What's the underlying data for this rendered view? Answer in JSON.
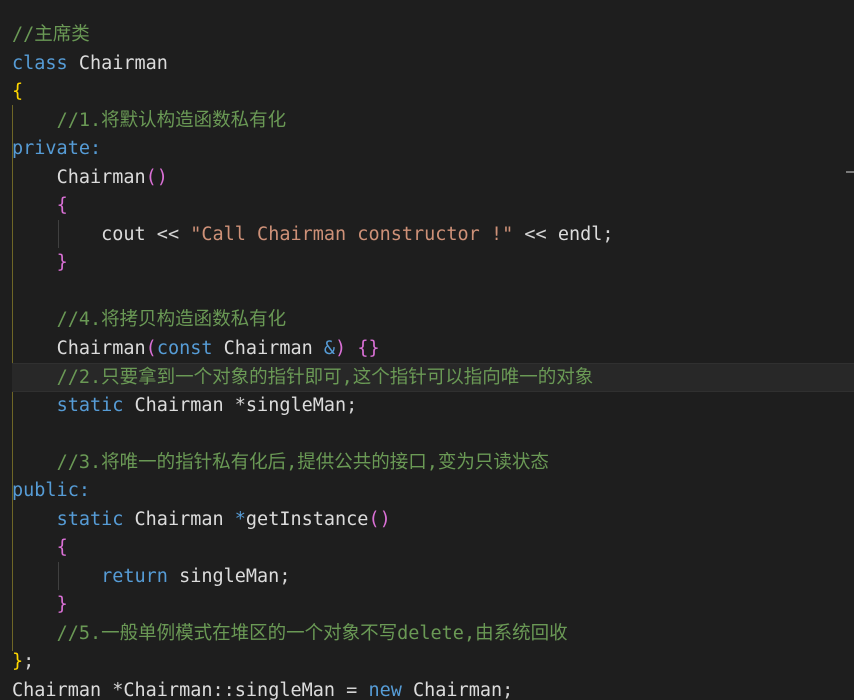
{
  "editor": {
    "language": "C++",
    "lines": [
      {
        "indent": "",
        "tokens": [
          {
            "t": "//主席类",
            "c": "t-comment"
          }
        ]
      },
      {
        "indent": "",
        "tokens": [
          {
            "t": "class",
            "c": "t-kw"
          },
          {
            "t": " "
          },
          {
            "t": "Chairman",
            "c": "t-type"
          }
        ]
      },
      {
        "indent": "",
        "tokens": [
          {
            "t": "{",
            "c": "t-p1"
          }
        ]
      },
      {
        "indent": "    ",
        "tokens": [
          {
            "t": "//1.将默认构造函数私有化",
            "c": "t-comment"
          }
        ]
      },
      {
        "indent": "",
        "tokens": [
          {
            "t": "private:",
            "c": "t-kw"
          }
        ]
      },
      {
        "indent": "    ",
        "tokens": [
          {
            "t": "Chairman",
            "c": "t-ident"
          },
          {
            "t": "()",
            "c": "t-p2"
          }
        ]
      },
      {
        "indent": "    ",
        "tokens": [
          {
            "t": "{",
            "c": "t-p2"
          }
        ]
      },
      {
        "indent": "        ",
        "tokens": [
          {
            "t": "cout",
            "c": "t-ident"
          },
          {
            "t": " << ",
            "c": "t-op"
          },
          {
            "t": "\"Call Chairman constructor !\"",
            "c": "t-str"
          },
          {
            "t": " << ",
            "c": "t-op"
          },
          {
            "t": "endl",
            "c": "t-ident"
          },
          {
            "t": ";",
            "c": "t-op"
          }
        ]
      },
      {
        "indent": "    ",
        "tokens": [
          {
            "t": "}",
            "c": "t-p2"
          }
        ]
      },
      {
        "indent": "",
        "tokens": []
      },
      {
        "indent": "    ",
        "tokens": [
          {
            "t": "//4.将拷贝构造函数私有化",
            "c": "t-comment"
          }
        ]
      },
      {
        "indent": "    ",
        "tokens": [
          {
            "t": "Chairman",
            "c": "t-ident"
          },
          {
            "t": "(",
            "c": "t-p2"
          },
          {
            "t": "const",
            "c": "t-kw"
          },
          {
            "t": " "
          },
          {
            "t": "Chairman",
            "c": "t-type"
          },
          {
            "t": " "
          },
          {
            "t": "&",
            "c": "t-kw"
          },
          {
            "t": ")",
            "c": "t-p2"
          },
          {
            "t": " "
          },
          {
            "t": "{}",
            "c": "t-p2"
          }
        ]
      },
      {
        "indent": "    ",
        "active": true,
        "tokens": [
          {
            "t": "//2.只要拿到一个对象的指针即可,这个指针可以指向唯一的对象",
            "c": "t-comment"
          }
        ]
      },
      {
        "indent": "    ",
        "tokens": [
          {
            "t": "static",
            "c": "t-kw"
          },
          {
            "t": " "
          },
          {
            "t": "Chairman",
            "c": "t-type"
          },
          {
            "t": " "
          },
          {
            "t": "*",
            "c": "t-op"
          },
          {
            "t": "singleMan",
            "c": "t-ident"
          },
          {
            "t": ";",
            "c": "t-op"
          }
        ]
      },
      {
        "indent": "",
        "tokens": []
      },
      {
        "indent": "    ",
        "tokens": [
          {
            "t": "//3.将唯一的指针私有化后,提供公共的接口,变为只读状态",
            "c": "t-comment"
          }
        ]
      },
      {
        "indent": "",
        "tokens": [
          {
            "t": "public:",
            "c": "t-kw"
          }
        ]
      },
      {
        "indent": "    ",
        "tokens": [
          {
            "t": "static",
            "c": "t-kw"
          },
          {
            "t": " "
          },
          {
            "t": "Chairman",
            "c": "t-type"
          },
          {
            "t": " "
          },
          {
            "t": "*",
            "c": "t-kw"
          },
          {
            "t": "getInstance",
            "c": "t-ident"
          },
          {
            "t": "()",
            "c": "t-p2"
          }
        ]
      },
      {
        "indent": "    ",
        "tokens": [
          {
            "t": "{",
            "c": "t-p2"
          }
        ]
      },
      {
        "indent": "        ",
        "tokens": [
          {
            "t": "return",
            "c": "t-kw"
          },
          {
            "t": " "
          },
          {
            "t": "singleMan",
            "c": "t-ident"
          },
          {
            "t": ";",
            "c": "t-op"
          }
        ]
      },
      {
        "indent": "    ",
        "tokens": [
          {
            "t": "}",
            "c": "t-p2"
          }
        ]
      },
      {
        "indent": "    ",
        "tokens": [
          {
            "t": "//5.一般单例模式在堆区的一个对象不写delete,由系统回收",
            "c": "t-comment"
          }
        ]
      },
      {
        "indent": "",
        "tokens": [
          {
            "t": "}",
            "c": "t-p1"
          },
          {
            "t": ";",
            "c": "t-op"
          }
        ]
      },
      {
        "indent": "",
        "tokens": [
          {
            "t": "Chairman",
            "c": "t-type"
          },
          {
            "t": " "
          },
          {
            "t": "*",
            "c": "t-op"
          },
          {
            "t": "Chairman",
            "c": "t-type"
          },
          {
            "t": "::",
            "c": "t-op"
          },
          {
            "t": "singleMan",
            "c": "t-ident"
          },
          {
            "t": " = ",
            "c": "t-op"
          },
          {
            "t": "new",
            "c": "t-kw"
          },
          {
            "t": " "
          },
          {
            "t": "Chairman",
            "c": "t-type"
          },
          {
            "t": ";",
            "c": "t-op"
          }
        ]
      }
    ]
  }
}
